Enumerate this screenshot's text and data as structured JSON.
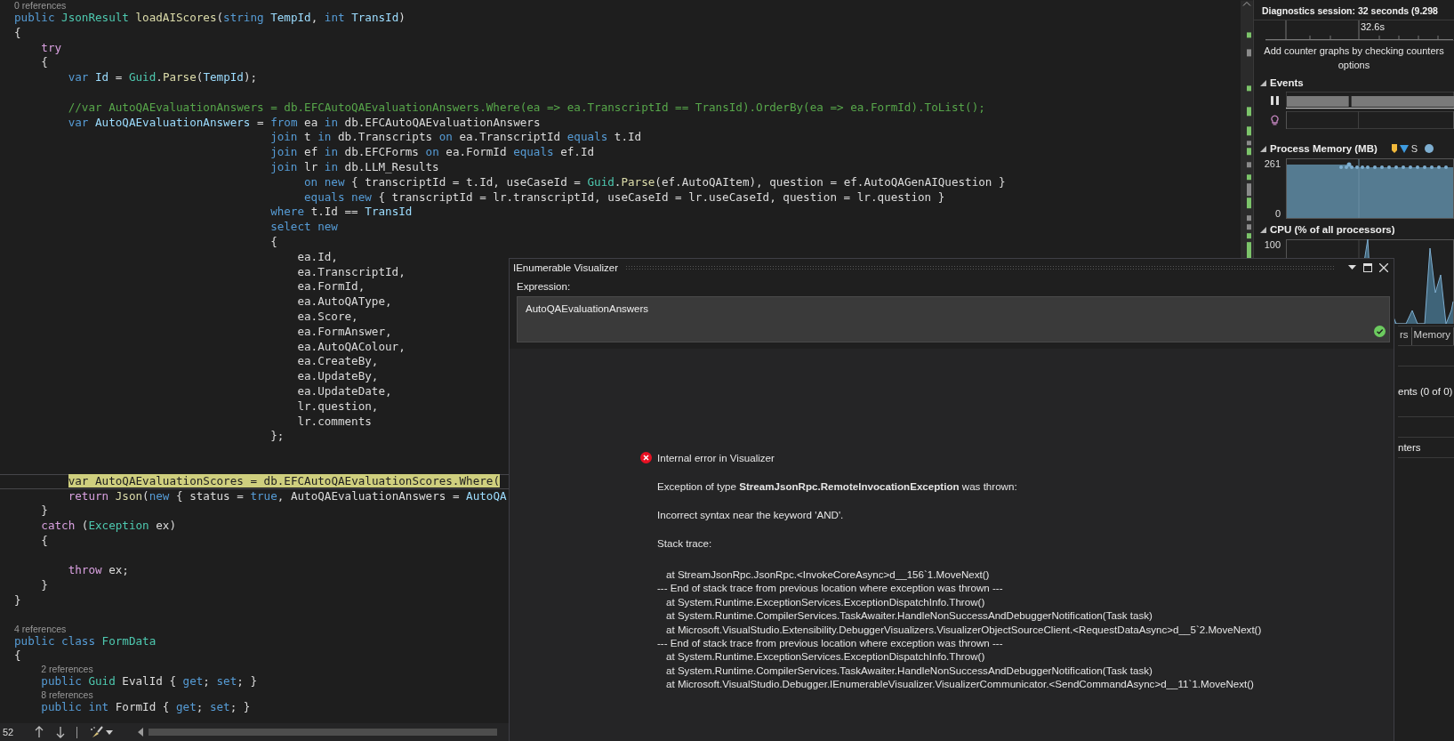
{
  "editor": {
    "lines": [
      {
        "kind": "lens",
        "text": "0 references"
      },
      {
        "kind": "code",
        "highlighted": false,
        "tokens": [
          {
            "kind": "kw",
            "text": "public "
          },
          {
            "kind": "type",
            "text": "JsonResult "
          },
          {
            "kind": "fn",
            "text": "loadAIScores"
          },
          {
            "kind": "txt",
            "text": "("
          },
          {
            "kind": "kw",
            "text": "string "
          },
          {
            "kind": "var",
            "text": "TempId"
          },
          {
            "kind": "txt",
            "text": ", "
          },
          {
            "kind": "kw",
            "text": "int "
          },
          {
            "kind": "var",
            "text": "TransId"
          },
          {
            "kind": "txt",
            "text": ")"
          }
        ]
      },
      {
        "kind": "code",
        "highlighted": false,
        "tokens": [
          {
            "kind": "txt",
            "text": "{"
          }
        ]
      },
      {
        "kind": "code",
        "highlighted": false,
        "tokens": [
          {
            "kind": "ctl",
            "text": "    try"
          }
        ]
      },
      {
        "kind": "code",
        "highlighted": false,
        "tokens": [
          {
            "kind": "txt",
            "text": "    {"
          }
        ]
      },
      {
        "kind": "code",
        "highlighted": false,
        "tokens": [
          {
            "kind": "kw",
            "text": "        var "
          },
          {
            "kind": "var",
            "text": "Id"
          },
          {
            "kind": "txt",
            "text": " = "
          },
          {
            "kind": "type",
            "text": "Guid"
          },
          {
            "kind": "txt",
            "text": "."
          },
          {
            "kind": "fn",
            "text": "Parse"
          },
          {
            "kind": "txt",
            "text": "("
          },
          {
            "kind": "var",
            "text": "TempId"
          },
          {
            "kind": "txt",
            "text": ");"
          }
        ]
      },
      {
        "kind": "blank"
      },
      {
        "kind": "code",
        "highlighted": false,
        "tokens": [
          {
            "kind": "cmt",
            "text": "        //var AutoQAEvaluationAnswers = db.EFCAutoQAEvaluationAnswers.Where(ea => ea.TranscriptId == TransId).OrderBy(ea => ea.FormId).ToList();"
          }
        ]
      },
      {
        "kind": "code",
        "highlighted": false,
        "tokens": [
          {
            "kind": "kw",
            "text": "        var "
          },
          {
            "kind": "var",
            "text": "AutoQAEvaluationAnswers"
          },
          {
            "kind": "txt",
            "text": " = "
          },
          {
            "kind": "kw",
            "text": "from "
          },
          {
            "kind": "txt",
            "text": "ea "
          },
          {
            "kind": "kw",
            "text": "in "
          },
          {
            "kind": "txt",
            "text": "db.EFCAutoQAEvaluationAnswers"
          }
        ]
      },
      {
        "kind": "code",
        "highlighted": false,
        "tokens": [
          {
            "kind": "kw",
            "text": "                                      join "
          },
          {
            "kind": "txt",
            "text": "t "
          },
          {
            "kind": "kw",
            "text": "in "
          },
          {
            "kind": "txt",
            "text": "db.Transcripts "
          },
          {
            "kind": "kw",
            "text": "on "
          },
          {
            "kind": "txt",
            "text": "ea.TranscriptId "
          },
          {
            "kind": "kw",
            "text": "equals "
          },
          {
            "kind": "txt",
            "text": "t.Id"
          }
        ]
      },
      {
        "kind": "code",
        "highlighted": false,
        "tokens": [
          {
            "kind": "kw",
            "text": "                                      join "
          },
          {
            "kind": "txt",
            "text": "ef "
          },
          {
            "kind": "kw",
            "text": "in "
          },
          {
            "kind": "txt",
            "text": "db.EFCForms "
          },
          {
            "kind": "kw",
            "text": "on "
          },
          {
            "kind": "txt",
            "text": "ea.FormId "
          },
          {
            "kind": "kw",
            "text": "equals "
          },
          {
            "kind": "txt",
            "text": "ef.Id"
          }
        ]
      },
      {
        "kind": "code",
        "highlighted": false,
        "tokens": [
          {
            "kind": "kw",
            "text": "                                      join "
          },
          {
            "kind": "txt",
            "text": "lr "
          },
          {
            "kind": "kw",
            "text": "in "
          },
          {
            "kind": "txt",
            "text": "db.LLM_Results"
          }
        ]
      },
      {
        "kind": "code",
        "highlighted": false,
        "tokens": [
          {
            "kind": "kw",
            "text": "                                           on new "
          },
          {
            "kind": "txt",
            "text": "{ transcriptId = t.Id, useCaseId = "
          },
          {
            "kind": "type",
            "text": "Guid"
          },
          {
            "kind": "txt",
            "text": "."
          },
          {
            "kind": "fn",
            "text": "Parse"
          },
          {
            "kind": "txt",
            "text": "(ef.AutoQAItem), question = ef.AutoQAGenAIQuestion }"
          }
        ]
      },
      {
        "kind": "code",
        "highlighted": false,
        "tokens": [
          {
            "kind": "kw",
            "text": "                                           equals new "
          },
          {
            "kind": "txt",
            "text": "{ transcriptId = lr.transcriptId, useCaseId = lr.useCaseId, question = lr.question }"
          }
        ]
      },
      {
        "kind": "code",
        "highlighted": false,
        "tokens": [
          {
            "kind": "kw",
            "text": "                                      where "
          },
          {
            "kind": "txt",
            "text": "t.Id == "
          },
          {
            "kind": "var",
            "text": "TransId"
          }
        ]
      },
      {
        "kind": "code",
        "highlighted": false,
        "tokens": [
          {
            "kind": "kw",
            "text": "                                      select new"
          }
        ]
      },
      {
        "kind": "code",
        "highlighted": false,
        "tokens": [
          {
            "kind": "txt",
            "text": "                                      {"
          }
        ]
      },
      {
        "kind": "code",
        "highlighted": false,
        "tokens": [
          {
            "kind": "txt",
            "text": "                                          ea.Id,"
          }
        ]
      },
      {
        "kind": "code",
        "highlighted": false,
        "tokens": [
          {
            "kind": "txt",
            "text": "                                          ea.TranscriptId,"
          }
        ]
      },
      {
        "kind": "code",
        "highlighted": false,
        "tokens": [
          {
            "kind": "txt",
            "text": "                                          ea.FormId,"
          }
        ]
      },
      {
        "kind": "code",
        "highlighted": false,
        "tokens": [
          {
            "kind": "txt",
            "text": "                                          ea.AutoQAType,"
          }
        ]
      },
      {
        "kind": "code",
        "highlighted": false,
        "tokens": [
          {
            "kind": "txt",
            "text": "                                          ea.Score,"
          }
        ]
      },
      {
        "kind": "code",
        "highlighted": false,
        "tokens": [
          {
            "kind": "txt",
            "text": "                                          ea.FormAnswer,"
          }
        ]
      },
      {
        "kind": "code",
        "highlighted": false,
        "tokens": [
          {
            "kind": "txt",
            "text": "                                          ea.AutoQAColour,"
          }
        ]
      },
      {
        "kind": "code",
        "highlighted": false,
        "tokens": [
          {
            "kind": "txt",
            "text": "                                          ea.CreateBy,"
          }
        ]
      },
      {
        "kind": "code",
        "highlighted": false,
        "tokens": [
          {
            "kind": "txt",
            "text": "                                          ea.UpdateBy,"
          }
        ]
      },
      {
        "kind": "code",
        "highlighted": false,
        "tokens": [
          {
            "kind": "txt",
            "text": "                                          ea.UpdateDate,"
          }
        ]
      },
      {
        "kind": "code",
        "highlighted": false,
        "tokens": [
          {
            "kind": "txt",
            "text": "                                          lr.question,"
          }
        ]
      },
      {
        "kind": "code",
        "highlighted": false,
        "tokens": [
          {
            "kind": "txt",
            "text": "                                          lr.comments"
          }
        ]
      },
      {
        "kind": "code",
        "highlighted": false,
        "tokens": [
          {
            "kind": "txt",
            "text": "                                      };"
          }
        ]
      },
      {
        "kind": "blank"
      },
      {
        "kind": "blank"
      },
      {
        "kind": "code",
        "highlighted": true,
        "tokens": [
          {
            "kind": "kw",
            "text": "        var "
          },
          {
            "kind": "var",
            "text": "AutoQAEvaluationScores"
          },
          {
            "kind": "txt",
            "text": " = db.EFCAutoQAEvaluationScores."
          },
          {
            "kind": "fn",
            "text": "Where"
          },
          {
            "kind": "txt",
            "text": "("
          }
        ]
      },
      {
        "kind": "code",
        "highlighted": false,
        "tokens": [
          {
            "kind": "ctl",
            "text": "        return "
          },
          {
            "kind": "fn",
            "text": "Json"
          },
          {
            "kind": "txt",
            "text": "("
          },
          {
            "kind": "kw",
            "text": "new "
          },
          {
            "kind": "txt",
            "text": "{ status = "
          },
          {
            "kind": "kw",
            "text": "true"
          },
          {
            "kind": "txt",
            "text": ", AutoQAEvaluationAnswers = "
          },
          {
            "kind": "var",
            "text": "AutoQA"
          }
        ]
      },
      {
        "kind": "code",
        "highlighted": false,
        "tokens": [
          {
            "kind": "txt",
            "text": "    }"
          }
        ]
      },
      {
        "kind": "code",
        "highlighted": false,
        "tokens": [
          {
            "kind": "ctl",
            "text": "    catch "
          },
          {
            "kind": "txt",
            "text": "("
          },
          {
            "kind": "type",
            "text": "Exception "
          },
          {
            "kind": "txt",
            "text": "ex)"
          }
        ]
      },
      {
        "kind": "code",
        "highlighted": false,
        "tokens": [
          {
            "kind": "txt",
            "text": "    {"
          }
        ]
      },
      {
        "kind": "blank"
      },
      {
        "kind": "code",
        "highlighted": false,
        "tokens": [
          {
            "kind": "ctl",
            "text": "        throw "
          },
          {
            "kind": "txt",
            "text": "ex;"
          }
        ]
      },
      {
        "kind": "code",
        "highlighted": false,
        "tokens": [
          {
            "kind": "txt",
            "text": "    }"
          }
        ]
      },
      {
        "kind": "code",
        "highlighted": false,
        "tokens": [
          {
            "kind": "txt",
            "text": "}"
          }
        ]
      },
      {
        "kind": "blank"
      },
      {
        "kind": "lens",
        "text": "4 references"
      },
      {
        "kind": "code",
        "highlighted": false,
        "tokens": [
          {
            "kind": "kw",
            "text": "public class "
          },
          {
            "kind": "type",
            "text": "FormData"
          }
        ]
      },
      {
        "kind": "code",
        "highlighted": false,
        "tokens": [
          {
            "kind": "txt",
            "text": "{"
          }
        ]
      },
      {
        "kind": "lens",
        "nested": true,
        "text": "2 references"
      },
      {
        "kind": "code",
        "highlighted": false,
        "tokens": [
          {
            "kind": "kw",
            "text": "    public "
          },
          {
            "kind": "type",
            "text": "Guid "
          },
          {
            "kind": "txt",
            "text": "EvalId { "
          },
          {
            "kind": "kw",
            "text": "get"
          },
          {
            "kind": "txt",
            "text": "; "
          },
          {
            "kind": "kw",
            "text": "set"
          },
          {
            "kind": "txt",
            "text": "; }"
          }
        ]
      },
      {
        "kind": "lens",
        "nested": true,
        "text": "8 references"
      },
      {
        "kind": "code",
        "highlighted": false,
        "tokens": [
          {
            "kind": "kw",
            "text": "    public int "
          },
          {
            "kind": "txt",
            "text": "FormId { "
          },
          {
            "kind": "kw",
            "text": "get"
          },
          {
            "kind": "txt",
            "text": "; "
          },
          {
            "kind": "kw",
            "text": "set"
          },
          {
            "kind": "txt",
            "text": "; }"
          }
        ]
      }
    ],
    "status_bar": {
      "zoom": "52"
    }
  },
  "diagnostics": {
    "title": "Diagnostics session: 32 seconds (9.298",
    "ruler_label": "32.6s",
    "hint_lines": [
      "Add counter graphs by checking counters",
      "options"
    ],
    "events": {
      "title": "Events"
    },
    "memory": {
      "title": "Process Memory (MB)",
      "legend": [
        {
          "kind": "marker",
          "color": "#f2b93b"
        },
        {
          "kind": "triangle",
          "label": "S",
          "color": "#3e9be0"
        },
        {
          "kind": "circle",
          "color": "#7eaed0"
        }
      ],
      "y_max": "261",
      "y_min": "0"
    },
    "cpu": {
      "title": "CPU (% of all processors)",
      "y_max": "100"
    },
    "tabs": [
      {
        "label": "rs",
        "selected": false
      },
      {
        "label": "Memory",
        "selected": false
      }
    ],
    "rows": [
      "ents (0 of 0)",
      "nters"
    ]
  },
  "visualizer": {
    "title": "IEnumerable Visualizer",
    "expression_label": "Expression:",
    "expression": "AutoQAEvaluationAnswers",
    "expression_valid": true,
    "error": {
      "title": "Internal error in Visualizer",
      "message": "Exception of type **StreamJsonRpc.RemoteInvocationException** was thrown:",
      "detail": "Incorrect syntax near the keyword 'AND'.",
      "stack_label": "Stack trace:",
      "stack_trace": [
        {
          "kind": "frame",
          "text": "at StreamJsonRpc.JsonRpc.<InvokeCoreAsync>d__156`1.MoveNext()"
        },
        {
          "kind": "separator",
          "text": "--- End of stack trace from previous location where exception was thrown ---"
        },
        {
          "kind": "frame",
          "text": "at System.Runtime.ExceptionServices.ExceptionDispatchInfo.Throw()"
        },
        {
          "kind": "frame",
          "text": "at System.Runtime.CompilerServices.TaskAwaiter.HandleNonSuccessAndDebuggerNotification(Task task)"
        },
        {
          "kind": "frame",
          "text": "at Microsoft.VisualStudio.Extensibility.DebuggerVisualizers.VisualizerObjectSourceClient.<RequestDataAsync>d__5`2.MoveNext()"
        },
        {
          "kind": "separator",
          "text": "--- End of stack trace from previous location where exception was thrown ---"
        },
        {
          "kind": "frame",
          "text": "at System.Runtime.ExceptionServices.ExceptionDispatchInfo.Throw()"
        },
        {
          "kind": "frame",
          "text": "at System.Runtime.CompilerServices.TaskAwaiter.HandleNonSuccessAndDebuggerNotification(Task task)"
        },
        {
          "kind": "frame",
          "text": "at Microsoft.VisualStudio.Debugger.IEnumerableVisualizer.VisualizerCommunicator.<SendCommandAsync>d__11`1.MoveNext()"
        }
      ]
    }
  }
}
